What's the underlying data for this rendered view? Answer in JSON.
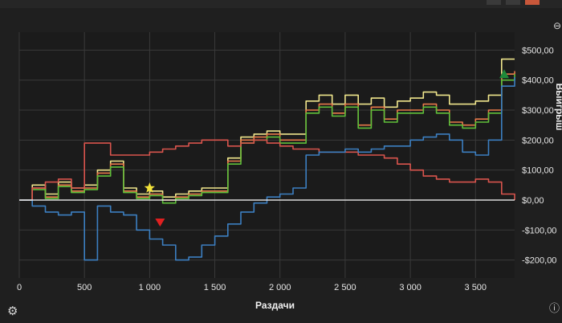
{
  "window": {
    "icons": [
      "settings-gear",
      "info",
      "zoom-out"
    ]
  },
  "chart_data": {
    "type": "line",
    "xlabel": "Раздачи",
    "ylabel": "Выигрыш",
    "xlim": [
      0,
      3800
    ],
    "ylim": [
      -260,
      560
    ],
    "x_ticks": [
      0,
      500,
      1000,
      1500,
      2000,
      2500,
      3000,
      3500
    ],
    "x_tick_labels": [
      "0",
      "500",
      "1 000",
      "1 500",
      "2 000",
      "2 500",
      "3 000",
      "3 500"
    ],
    "y_ticks": [
      -200,
      -100,
      0,
      100,
      200,
      300,
      400,
      500
    ],
    "y_tick_labels": [
      "-$200,00",
      "-$100,00",
      "$0,00",
      "$100,00",
      "$200,00",
      "$300,00",
      "$400,00",
      "$500,00"
    ],
    "grid": true,
    "zero_line": true,
    "series": [
      {
        "color": "#f0e68c",
        "x": [
          0,
          100,
          200,
          300,
          400,
          500,
          600,
          700,
          800,
          900,
          1000,
          1100,
          1200,
          1300,
          1400,
          1500,
          1600,
          1700,
          1800,
          1900,
          2000,
          2100,
          2200,
          2300,
          2400,
          2500,
          2600,
          2700,
          2800,
          2900,
          3000,
          3100,
          3200,
          3300,
          3400,
          3500,
          3600,
          3700,
          3800
        ],
        "values": [
          0,
          50,
          20,
          60,
          40,
          50,
          100,
          130,
          40,
          20,
          30,
          10,
          20,
          30,
          40,
          40,
          140,
          210,
          220,
          230,
          220,
          220,
          330,
          350,
          320,
          350,
          320,
          340,
          310,
          330,
          340,
          360,
          350,
          320,
          320,
          330,
          350,
          470,
          470
        ]
      },
      {
        "color": "#e8794a",
        "x": [
          0,
          100,
          200,
          300,
          400,
          500,
          600,
          700,
          800,
          900,
          1000,
          1100,
          1200,
          1300,
          1400,
          1500,
          1600,
          1700,
          1800,
          1900,
          2000,
          2100,
          2200,
          2300,
          2400,
          2500,
          2600,
          2700,
          2800,
          2900,
          3000,
          3100,
          3200,
          3300,
          3400,
          3500,
          3600,
          3700,
          3800
        ],
        "values": [
          0,
          40,
          10,
          50,
          30,
          40,
          90,
          120,
          30,
          10,
          20,
          0,
          10,
          20,
          30,
          30,
          130,
          200,
          210,
          220,
          200,
          200,
          300,
          320,
          290,
          320,
          250,
          310,
          270,
          300,
          300,
          320,
          300,
          260,
          250,
          270,
          300,
          420,
          430
        ]
      },
      {
        "color": "#5fbf3a",
        "x": [
          0,
          100,
          200,
          300,
          400,
          500,
          600,
          700,
          800,
          900,
          1000,
          1100,
          1200,
          1300,
          1400,
          1500,
          1600,
          1700,
          1800,
          1900,
          2000,
          2100,
          2200,
          2300,
          2400,
          2500,
          2600,
          2700,
          2800,
          2900,
          3000,
          3100,
          3200,
          3300,
          3400,
          3500,
          3600,
          3700,
          3800
        ],
        "values": [
          0,
          35,
          5,
          45,
          25,
          35,
          80,
          110,
          25,
          5,
          15,
          -10,
          5,
          15,
          25,
          25,
          120,
          190,
          200,
          210,
          190,
          190,
          290,
          310,
          280,
          310,
          240,
          300,
          260,
          290,
          290,
          310,
          290,
          250,
          240,
          260,
          290,
          400,
          420
        ]
      },
      {
        "color": "#d9544d",
        "x": [
          0,
          100,
          200,
          300,
          400,
          500,
          600,
          700,
          800,
          900,
          1000,
          1100,
          1200,
          1300,
          1400,
          1500,
          1600,
          1700,
          1800,
          1900,
          2000,
          2100,
          2200,
          2300,
          2400,
          2500,
          2600,
          2700,
          2800,
          2900,
          3000,
          3100,
          3200,
          3300,
          3400,
          3500,
          3600,
          3700,
          3800
        ],
        "values": [
          0,
          40,
          60,
          70,
          40,
          190,
          190,
          150,
          150,
          150,
          160,
          170,
          180,
          190,
          200,
          200,
          180,
          190,
          200,
          190,
          180,
          170,
          170,
          160,
          160,
          160,
          150,
          150,
          140,
          120,
          100,
          80,
          70,
          60,
          60,
          70,
          60,
          20,
          0
        ]
      },
      {
        "color": "#3c7fc1",
        "x": [
          0,
          100,
          200,
          300,
          400,
          500,
          600,
          700,
          800,
          900,
          1000,
          1100,
          1200,
          1300,
          1400,
          1500,
          1600,
          1700,
          1800,
          1900,
          2000,
          2100,
          2200,
          2300,
          2400,
          2500,
          2600,
          2700,
          2800,
          2900,
          3000,
          3100,
          3200,
          3300,
          3400,
          3500,
          3600,
          3700,
          3800
        ],
        "values": [
          0,
          -20,
          -40,
          -50,
          -40,
          -200,
          -20,
          -40,
          -50,
          -100,
          -130,
          -150,
          -200,
          -190,
          -150,
          -120,
          -80,
          -40,
          -10,
          10,
          20,
          40,
          150,
          160,
          160,
          170,
          160,
          170,
          180,
          180,
          200,
          210,
          220,
          200,
          160,
          150,
          200,
          380,
          410
        ]
      }
    ],
    "markers": [
      {
        "type": "star",
        "color": "#f2e23a",
        "x": 1000,
        "y": 40
      },
      {
        "type": "triangle-down",
        "color": "#e02020",
        "x": 1080,
        "y": -75
      },
      {
        "type": "triangle-up",
        "color": "#1f8a3a",
        "x": 3720,
        "y": 420
      }
    ]
  }
}
